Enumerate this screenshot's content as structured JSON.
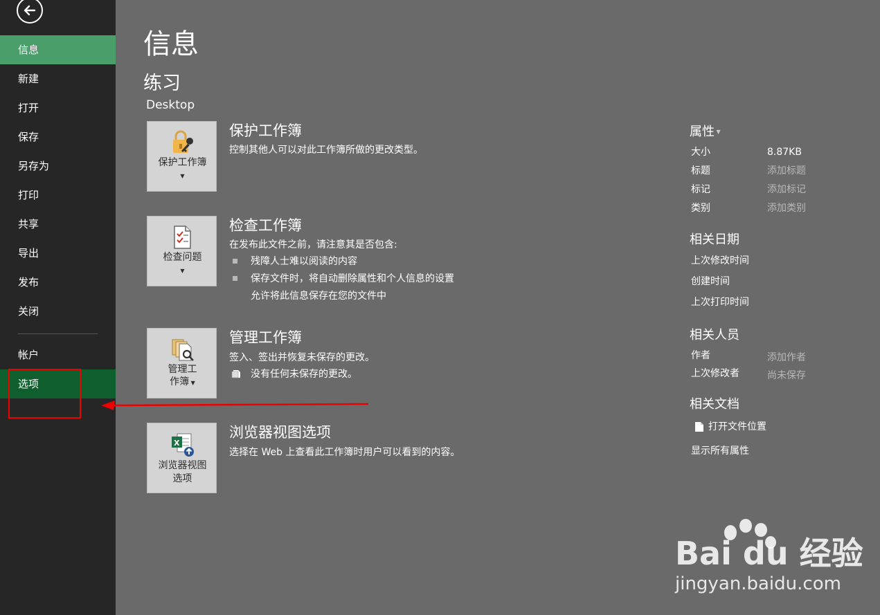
{
  "sidebar": {
    "items": [
      {
        "label": "信息"
      },
      {
        "label": "新建"
      },
      {
        "label": "打开"
      },
      {
        "label": "保存"
      },
      {
        "label": "另存为"
      },
      {
        "label": "打印"
      },
      {
        "label": "共享"
      },
      {
        "label": "导出"
      },
      {
        "label": "发布"
      },
      {
        "label": "关闭"
      },
      {
        "label": "帐户"
      },
      {
        "label": "选项"
      }
    ]
  },
  "main": {
    "title": "信息",
    "doc_name": "练习",
    "doc_location": "Desktop",
    "sections": {
      "protect": {
        "tile_label": "保护工作簿",
        "title": "保护工作簿",
        "desc": "控制其他人可以对此工作簿所做的更改类型。"
      },
      "inspect": {
        "tile_label": "检查问题",
        "title": "检查工作簿",
        "desc": "在发布此文件之前，请注意其是否包含:",
        "bullets": [
          "残障人士难以阅读的内容",
          "保存文件时，将自动删除属性和个人信息的设置"
        ],
        "note": "允许将此信息保存在您的文件中"
      },
      "manage": {
        "tile_label_1": "管理工",
        "tile_label_2": "作簿",
        "title": "管理工作簿",
        "desc": "签入、签出并恢复未保存的更改。",
        "item": "没有任何未保存的更改。"
      },
      "browser": {
        "tile_label_1": "浏览器视图",
        "tile_label_2": "选项",
        "title": "浏览器视图选项",
        "desc": "选择在 Web 上查看此工作簿时用户可以看到的内容。"
      }
    }
  },
  "properties": {
    "heading": "属性",
    "rows": [
      {
        "label": "大小",
        "value": "8.87KB"
      },
      {
        "label": "标题",
        "value": "添加标题"
      },
      {
        "label": "标记",
        "value": "添加标记"
      },
      {
        "label": "类别",
        "value": "添加类别"
      }
    ],
    "dates_heading": "相关日期",
    "dates": [
      "上次修改时间",
      "创建时间",
      "上次打印时间"
    ],
    "people_heading": "相关人员",
    "people": [
      {
        "label": "作者",
        "value": "添加作者"
      },
      {
        "label": "上次修改者",
        "value": "尚未保存"
      }
    ],
    "docs_heading": "相关文档",
    "open_location": "打开文件位置",
    "show_all": "显示所有属性"
  },
  "watermark": {
    "brand": "Bai du 经验",
    "url": "jingyan.baidu.com"
  },
  "colors": {
    "sidebar_bg": "#262626",
    "active_green": "#4a9e6a",
    "highlight_green": "#0f5f2e",
    "content_bg": "#6a6a6a",
    "annotation_red": "#e00000"
  }
}
